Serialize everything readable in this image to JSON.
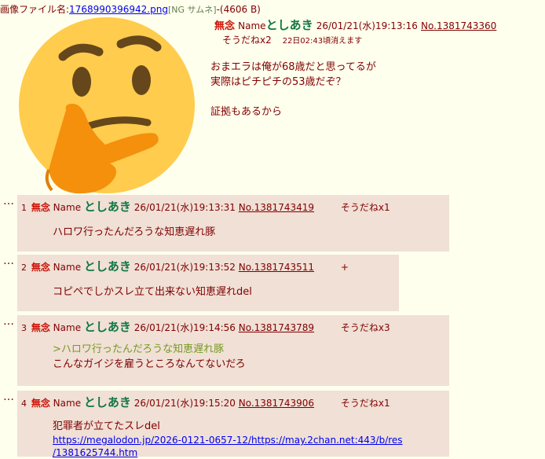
{
  "file": {
    "label": "画像ファイル名:",
    "name": "1768990396942.png",
    "ng": "[NG サムネ]",
    "size": "-(4606 B)"
  },
  "op": {
    "subject": "無念",
    "name_label": "Name",
    "name": "としあき",
    "datetime": "26/01/21(水)19:13:16",
    "number": "No.1381743360",
    "sodane": "そうだねx2",
    "delete_time": "22日02:43頃消えます",
    "body": [
      "おまエラは俺が68歳だと思ってるが",
      "実際はピチピチの53歳だぞ？",
      "",
      "証拠もあるから"
    ]
  },
  "replies": [
    {
      "index": "1",
      "subject": "無念",
      "name_label": "Name",
      "name": "としあき",
      "datetime": "26/01/21(水)19:13:31",
      "number": "No.1381743419",
      "sodane": "そうだねx1",
      "lines": [
        {
          "text": "ハロワ行ったんだろうな知恵遅れ豚",
          "type": "text"
        }
      ]
    },
    {
      "index": "2",
      "subject": "無念",
      "name_label": "Name",
      "name": "としあき",
      "datetime": "26/01/21(水)19:13:52",
      "number": "No.1381743511",
      "sodane": "+",
      "lines": [
        {
          "text": "コピペでしかスレ立て出来ない知恵遅れdel",
          "type": "text"
        }
      ]
    },
    {
      "index": "3",
      "subject": "無念",
      "name_label": "Name",
      "name": "としあき",
      "datetime": "26/01/21(水)19:14:56",
      "number": "No.1381743789",
      "sodane": "そうだねx3",
      "lines": [
        {
          "text": ">ハロワ行ったんだろうな知恵遅れ豚",
          "type": "quote"
        },
        {
          "text": "こんなガイジを雇うところなんてないだろ",
          "type": "text"
        }
      ]
    },
    {
      "index": "4",
      "subject": "無念",
      "name_label": "Name",
      "name": "としあき",
      "datetime": "26/01/21(水)19:15:20",
      "number": "No.1381743906",
      "sodane": "そうだねx1",
      "lines": [
        {
          "text": "犯罪者が立てたスレdel",
          "type": "text"
        },
        {
          "text": "https://megalodon.jp/2026-0121-0657-12/https://may.2chan.net:443/b/res",
          "type": "link"
        },
        {
          "text": "/1381625744.htm",
          "type": "link"
        }
      ]
    }
  ],
  "colors": {
    "background": "#ffffee",
    "reply_bg": "#f0e0d6",
    "subject": "#cc1105",
    "name": "#117743",
    "quote": "#789922",
    "link": "#0000ee"
  },
  "thumbnail_icon": "thinking-face-emoji"
}
